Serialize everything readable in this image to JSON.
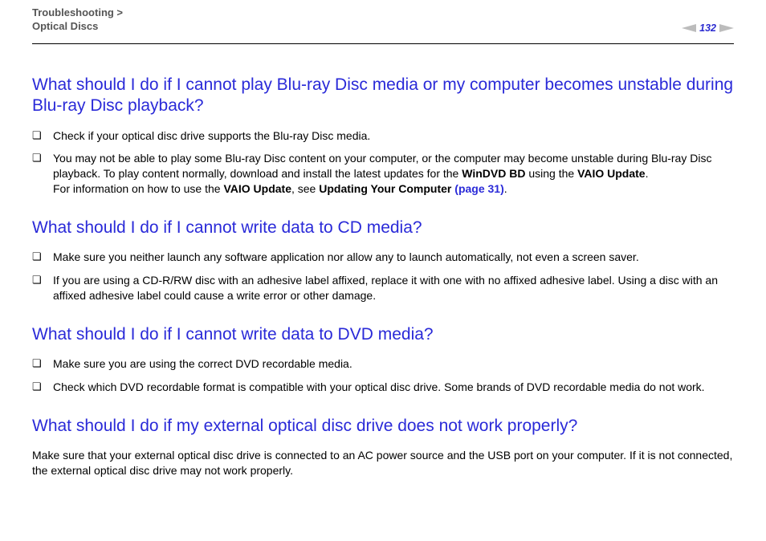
{
  "header": {
    "breadcrumb_line1": "Troubleshooting >",
    "breadcrumb_line2": "Optical Discs",
    "page_number": "132"
  },
  "sections": [
    {
      "heading": "What should I do if I cannot play Blu-ray Disc media or my computer becomes unstable during Blu-ray Disc playback?",
      "items": [
        {
          "text": "Check if your optical disc drive supports the Blu-ray Disc media."
        },
        {
          "pre": "You may not be able to play some Blu-ray Disc content on your computer, or the computer may become unstable during Blu-ray Disc playback. To play content normally, download and install the latest updates for the ",
          "b1": "WinDVD BD",
          "mid1": " using the ",
          "b2": "VAIO Update",
          "post1": ".",
          "line2_pre": "For information on how to use the ",
          "line2_b1": "VAIO Update",
          "line2_mid": ", see ",
          "line2_b2": "Updating Your Computer ",
          "line2_link": "(page 31)",
          "line2_post": "."
        }
      ]
    },
    {
      "heading": "What should I do if I cannot write data to CD media?",
      "items": [
        {
          "text": "Make sure you neither launch any software application nor allow any to launch automatically, not even a screen saver."
        },
        {
          "text": "If you are using a CD-R/RW disc with an adhesive label affixed, replace it with one with no affixed adhesive label. Using a disc with an affixed adhesive label could cause a write error or other damage."
        }
      ]
    },
    {
      "heading": "What should I do if I cannot write data to DVD media?",
      "items": [
        {
          "text": "Make sure you are using the correct DVD recordable media."
        },
        {
          "text": "Check which DVD recordable format is compatible with your optical disc drive. Some brands of DVD recordable media do not work."
        }
      ]
    },
    {
      "heading": "What should I do if my external optical disc drive does not work properly?",
      "body": "Make sure that your external optical disc drive is connected to an AC power source and the USB port on your computer. If it is not connected, the external optical disc drive may not work properly."
    }
  ]
}
